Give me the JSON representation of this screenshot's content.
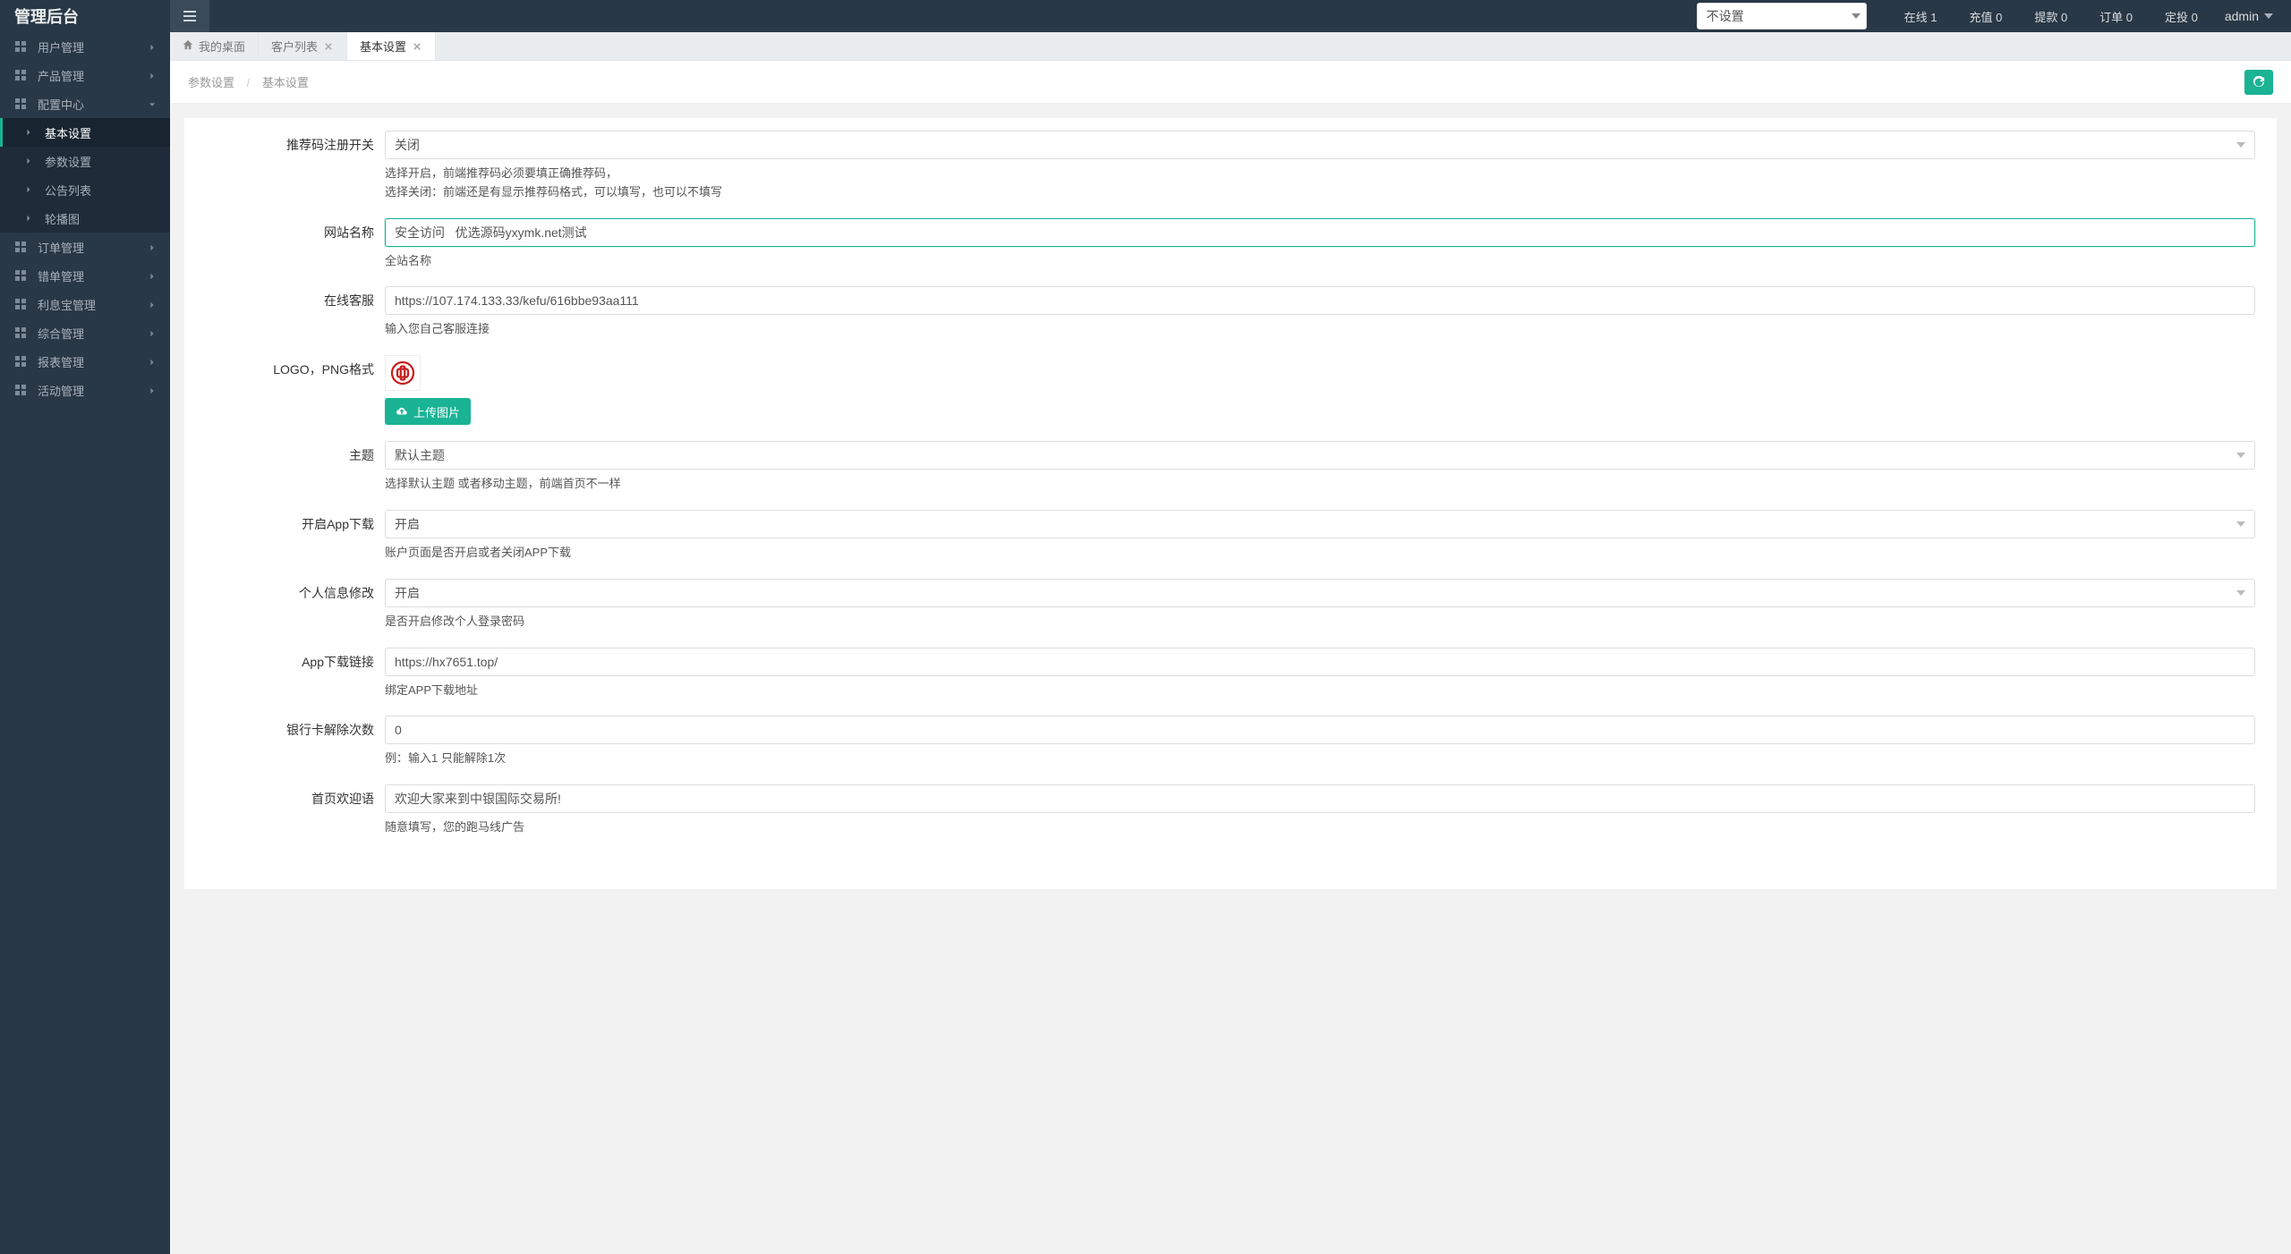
{
  "brand": "管理后台",
  "header_dropdown": "不设置",
  "header_stats": {
    "online": "在线 1",
    "recharge": "充值 0",
    "withdraw": "提款 0",
    "orders": "订单 0",
    "fixed": "定投 0"
  },
  "admin_label": "admin",
  "sidebar": {
    "items": [
      {
        "label": "用户管理",
        "expandable": true
      },
      {
        "label": "产品管理",
        "expandable": true
      },
      {
        "label": "配置中心",
        "expandable": true,
        "expanded": true,
        "children": [
          {
            "label": "基本设置",
            "active": true
          },
          {
            "label": "参数设置"
          },
          {
            "label": "公告列表"
          },
          {
            "label": "轮播图"
          }
        ]
      },
      {
        "label": "订单管理",
        "expandable": true
      },
      {
        "label": "错单管理",
        "expandable": true
      },
      {
        "label": "利息宝管理",
        "expandable": true
      },
      {
        "label": "综合管理",
        "expandable": true
      },
      {
        "label": "报表管理",
        "expandable": true
      },
      {
        "label": "活动管理",
        "expandable": true
      }
    ]
  },
  "tabs": [
    {
      "label": "我的桌面",
      "type": "home"
    },
    {
      "label": "客户列表",
      "closable": true
    },
    {
      "label": "基本设置",
      "closable": true,
      "active": true
    }
  ],
  "breadcrumb": {
    "parent": "参数设置",
    "current": "基本设置"
  },
  "form": {
    "recommend_switch": {
      "label": "推荐码注册开关",
      "value": "关闭",
      "help1": "选择开启，前端推荐码必须要填正确推荐码，",
      "help2": "选择关闭：前端还是有显示推荐码格式，可以填写，也可以不填写"
    },
    "site_name": {
      "label": "网站名称",
      "value": "安全访问   优选源码yxymk.net测试",
      "help": "全站名称"
    },
    "kefu": {
      "label": "在线客服",
      "value": "https://107.174.133.33/kefu/616bbe93aa111",
      "help": "输入您自己客服连接"
    },
    "logo": {
      "label": "LOGO，PNG格式",
      "upload_label": "上传图片"
    },
    "theme": {
      "label": "主题",
      "value": "默认主题",
      "help": "选择默认主题 或者移动主题，前端首页不一样"
    },
    "app_download": {
      "label": "开启App下载",
      "value": "开启",
      "help": "账户页面是否开启或者关闭APP下载"
    },
    "personal_edit": {
      "label": "个人信息修改",
      "value": "开启",
      "help": "是否开启修改个人登录密码"
    },
    "app_link": {
      "label": "App下载链接",
      "value": "https://hx7651.top/",
      "help": "绑定APP下载地址"
    },
    "bankcard_remove": {
      "label": "银行卡解除次数",
      "value": "0",
      "help": "例：输入1 只能解除1次"
    },
    "welcome": {
      "label": "首页欢迎语",
      "value": "欢迎大家来到中银国际交易所!",
      "help": "随意填写，您的跑马线广告"
    }
  }
}
